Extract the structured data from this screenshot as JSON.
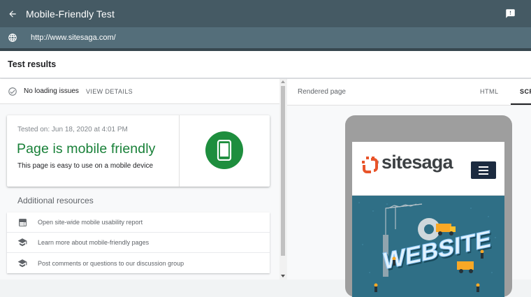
{
  "app": {
    "title": "Mobile-Friendly Test",
    "url": "http://www.sitesaga.com/"
  },
  "results": {
    "header": "Test results"
  },
  "issues": {
    "status": "No loading issues",
    "details_label": "VIEW DETAILS"
  },
  "summary": {
    "tested_on": "Tested on: Jun 18, 2020 at 4:01 PM",
    "verdict": "Page is mobile friendly",
    "description": "This page is easy to use on a mobile device"
  },
  "additional": {
    "heading": "Additional resources",
    "items": [
      {
        "label": "Open site-wide mobile usability report",
        "icon": "web-report-icon"
      },
      {
        "label": "Learn more about mobile-friendly pages",
        "icon": "school-icon"
      },
      {
        "label": "Post comments or questions to our discussion group",
        "icon": "school-icon"
      }
    ]
  },
  "preview": {
    "heading": "Rendered page",
    "tabs": [
      "HTML",
      "SCR"
    ],
    "active_tab": "SCR",
    "site_name": "sitesaga",
    "hero_text": "WEBSITE"
  },
  "colors": {
    "appbar": "#455a64",
    "urlbar": "#546e7a",
    "success": "#188038",
    "badge": "#1e8e3e",
    "logo_orange": "#e8542a",
    "menu_button": "#1c2b40",
    "hero_bg": "#2f6f86"
  }
}
